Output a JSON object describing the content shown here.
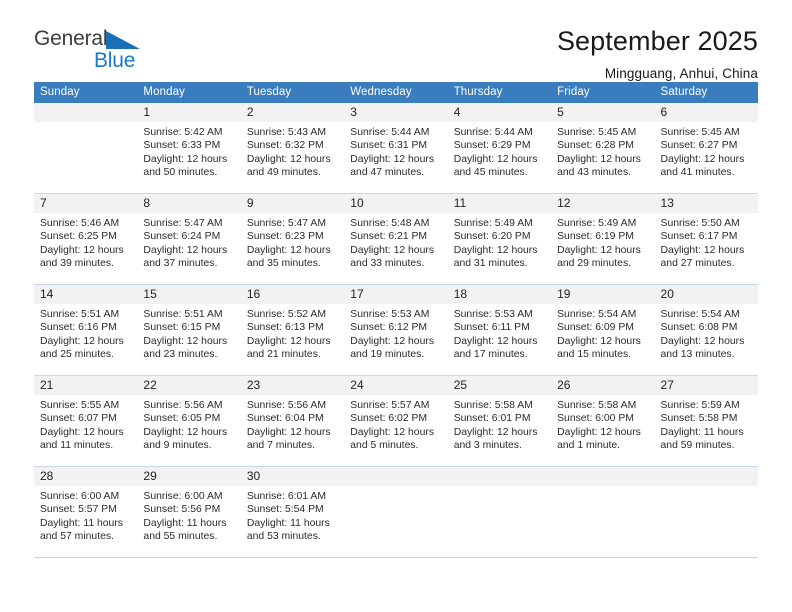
{
  "brand": {
    "name_part1": "General",
    "name_part2": "Blue",
    "flag_color": "#1a6fb5",
    "accent_color": "#1a7ac4"
  },
  "header": {
    "title": "September 2025",
    "subtitle": "Mingguang, Anhui, China"
  },
  "calendar": {
    "header_bg": "#3a7dbf",
    "daynum_bg": "#f2f2f2",
    "weekdays": [
      "Sunday",
      "Monday",
      "Tuesday",
      "Wednesday",
      "Thursday",
      "Friday",
      "Saturday"
    ],
    "weeks": [
      [
        {
          "day": "",
          "empty": true
        },
        {
          "day": "1",
          "sunrise": "Sunrise: 5:42 AM",
          "sunset": "Sunset: 6:33 PM",
          "daylight1": "Daylight: 12 hours",
          "daylight2": "and 50 minutes."
        },
        {
          "day": "2",
          "sunrise": "Sunrise: 5:43 AM",
          "sunset": "Sunset: 6:32 PM",
          "daylight1": "Daylight: 12 hours",
          "daylight2": "and 49 minutes."
        },
        {
          "day": "3",
          "sunrise": "Sunrise: 5:44 AM",
          "sunset": "Sunset: 6:31 PM",
          "daylight1": "Daylight: 12 hours",
          "daylight2": "and 47 minutes."
        },
        {
          "day": "4",
          "sunrise": "Sunrise: 5:44 AM",
          "sunset": "Sunset: 6:29 PM",
          "daylight1": "Daylight: 12 hours",
          "daylight2": "and 45 minutes."
        },
        {
          "day": "5",
          "sunrise": "Sunrise: 5:45 AM",
          "sunset": "Sunset: 6:28 PM",
          "daylight1": "Daylight: 12 hours",
          "daylight2": "and 43 minutes."
        },
        {
          "day": "6",
          "sunrise": "Sunrise: 5:45 AM",
          "sunset": "Sunset: 6:27 PM",
          "daylight1": "Daylight: 12 hours",
          "daylight2": "and 41 minutes."
        }
      ],
      [
        {
          "day": "7",
          "sunrise": "Sunrise: 5:46 AM",
          "sunset": "Sunset: 6:25 PM",
          "daylight1": "Daylight: 12 hours",
          "daylight2": "and 39 minutes."
        },
        {
          "day": "8",
          "sunrise": "Sunrise: 5:47 AM",
          "sunset": "Sunset: 6:24 PM",
          "daylight1": "Daylight: 12 hours",
          "daylight2": "and 37 minutes."
        },
        {
          "day": "9",
          "sunrise": "Sunrise: 5:47 AM",
          "sunset": "Sunset: 6:23 PM",
          "daylight1": "Daylight: 12 hours",
          "daylight2": "and 35 minutes."
        },
        {
          "day": "10",
          "sunrise": "Sunrise: 5:48 AM",
          "sunset": "Sunset: 6:21 PM",
          "daylight1": "Daylight: 12 hours",
          "daylight2": "and 33 minutes."
        },
        {
          "day": "11",
          "sunrise": "Sunrise: 5:49 AM",
          "sunset": "Sunset: 6:20 PM",
          "daylight1": "Daylight: 12 hours",
          "daylight2": "and 31 minutes."
        },
        {
          "day": "12",
          "sunrise": "Sunrise: 5:49 AM",
          "sunset": "Sunset: 6:19 PM",
          "daylight1": "Daylight: 12 hours",
          "daylight2": "and 29 minutes."
        },
        {
          "day": "13",
          "sunrise": "Sunrise: 5:50 AM",
          "sunset": "Sunset: 6:17 PM",
          "daylight1": "Daylight: 12 hours",
          "daylight2": "and 27 minutes."
        }
      ],
      [
        {
          "day": "14",
          "sunrise": "Sunrise: 5:51 AM",
          "sunset": "Sunset: 6:16 PM",
          "daylight1": "Daylight: 12 hours",
          "daylight2": "and 25 minutes."
        },
        {
          "day": "15",
          "sunrise": "Sunrise: 5:51 AM",
          "sunset": "Sunset: 6:15 PM",
          "daylight1": "Daylight: 12 hours",
          "daylight2": "and 23 minutes."
        },
        {
          "day": "16",
          "sunrise": "Sunrise: 5:52 AM",
          "sunset": "Sunset: 6:13 PM",
          "daylight1": "Daylight: 12 hours",
          "daylight2": "and 21 minutes."
        },
        {
          "day": "17",
          "sunrise": "Sunrise: 5:53 AM",
          "sunset": "Sunset: 6:12 PM",
          "daylight1": "Daylight: 12 hours",
          "daylight2": "and 19 minutes."
        },
        {
          "day": "18",
          "sunrise": "Sunrise: 5:53 AM",
          "sunset": "Sunset: 6:11 PM",
          "daylight1": "Daylight: 12 hours",
          "daylight2": "and 17 minutes."
        },
        {
          "day": "19",
          "sunrise": "Sunrise: 5:54 AM",
          "sunset": "Sunset: 6:09 PM",
          "daylight1": "Daylight: 12 hours",
          "daylight2": "and 15 minutes."
        },
        {
          "day": "20",
          "sunrise": "Sunrise: 5:54 AM",
          "sunset": "Sunset: 6:08 PM",
          "daylight1": "Daylight: 12 hours",
          "daylight2": "and 13 minutes."
        }
      ],
      [
        {
          "day": "21",
          "sunrise": "Sunrise: 5:55 AM",
          "sunset": "Sunset: 6:07 PM",
          "daylight1": "Daylight: 12 hours",
          "daylight2": "and 11 minutes."
        },
        {
          "day": "22",
          "sunrise": "Sunrise: 5:56 AM",
          "sunset": "Sunset: 6:05 PM",
          "daylight1": "Daylight: 12 hours",
          "daylight2": "and 9 minutes."
        },
        {
          "day": "23",
          "sunrise": "Sunrise: 5:56 AM",
          "sunset": "Sunset: 6:04 PM",
          "daylight1": "Daylight: 12 hours",
          "daylight2": "and 7 minutes."
        },
        {
          "day": "24",
          "sunrise": "Sunrise: 5:57 AM",
          "sunset": "Sunset: 6:02 PM",
          "daylight1": "Daylight: 12 hours",
          "daylight2": "and 5 minutes."
        },
        {
          "day": "25",
          "sunrise": "Sunrise: 5:58 AM",
          "sunset": "Sunset: 6:01 PM",
          "daylight1": "Daylight: 12 hours",
          "daylight2": "and 3 minutes."
        },
        {
          "day": "26",
          "sunrise": "Sunrise: 5:58 AM",
          "sunset": "Sunset: 6:00 PM",
          "daylight1": "Daylight: 12 hours",
          "daylight2": "and 1 minute."
        },
        {
          "day": "27",
          "sunrise": "Sunrise: 5:59 AM",
          "sunset": "Sunset: 5:58 PM",
          "daylight1": "Daylight: 11 hours",
          "daylight2": "and 59 minutes."
        }
      ],
      [
        {
          "day": "28",
          "sunrise": "Sunrise: 6:00 AM",
          "sunset": "Sunset: 5:57 PM",
          "daylight1": "Daylight: 11 hours",
          "daylight2": "and 57 minutes."
        },
        {
          "day": "29",
          "sunrise": "Sunrise: 6:00 AM",
          "sunset": "Sunset: 5:56 PM",
          "daylight1": "Daylight: 11 hours",
          "daylight2": "and 55 minutes."
        },
        {
          "day": "30",
          "sunrise": "Sunrise: 6:01 AM",
          "sunset": "Sunset: 5:54 PM",
          "daylight1": "Daylight: 11 hours",
          "daylight2": "and 53 minutes."
        },
        {
          "day": "",
          "empty": true
        },
        {
          "day": "",
          "empty": true
        },
        {
          "day": "",
          "empty": true
        },
        {
          "day": "",
          "empty": true
        }
      ]
    ]
  }
}
